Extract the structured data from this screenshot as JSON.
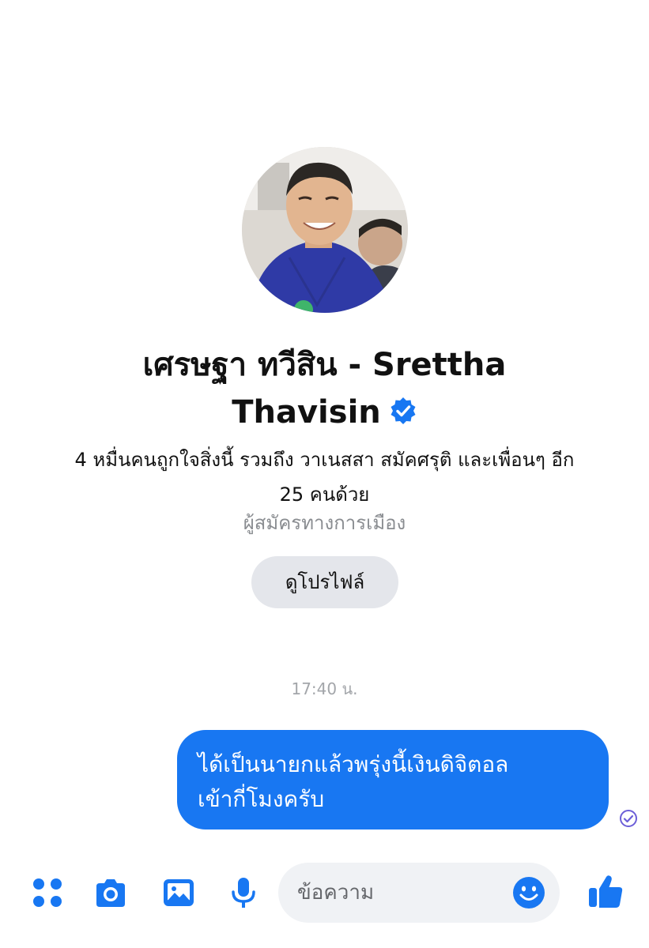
{
  "profile": {
    "avatar_alt": "profile photo",
    "name_line1": "เศรษฐา ทวีสิน - Srettha",
    "name_line2": "Thavisin",
    "verified_icon": "verified-badge-icon",
    "likes_line1": "4 หมื่นคนถูกใจสิ่งนี้ รวมถึง วาเนสสา สมัคศรุติ และเพื่อนๆ อีก",
    "likes_line2": "25 คนด้วย",
    "category": "ผู้สมัครทางการเมือง",
    "view_profile_label": "ดูโปรไฟล์"
  },
  "conversation": {
    "timestamp": "17:40 น.",
    "messages": [
      {
        "sender": "me",
        "line1": "ได้เป็นนายกแล้วพรุ่งนี้เงินดิจิตอล",
        "line2": "เข้ากี่โมงครับ",
        "status_icon": "seen-check-icon"
      }
    ]
  },
  "composer": {
    "icons": [
      "more-actions-icon",
      "camera-icon",
      "gallery-icon",
      "microphone-icon",
      "emoji-icon",
      "like-thumb-icon"
    ],
    "placeholder": "ข้อความ"
  },
  "colors": {
    "accent": "#1877f2",
    "bubble_text": "#ffffff",
    "muted_text": "#8a8d91",
    "input_bg": "#f0f2f5"
  }
}
